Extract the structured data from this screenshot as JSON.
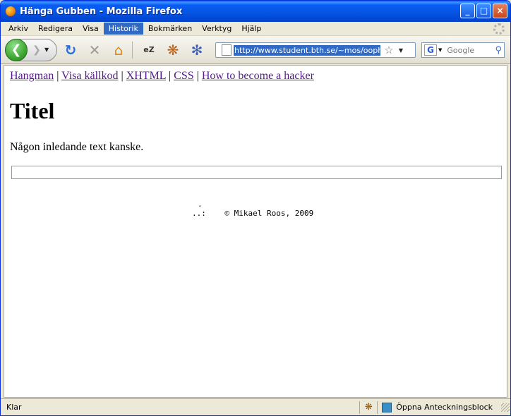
{
  "window": {
    "title": "Hänga Gubben - Mozilla Firefox"
  },
  "menu": {
    "items": [
      {
        "label": "Arkiv"
      },
      {
        "label": "Redigera"
      },
      {
        "label": "Visa"
      },
      {
        "label": "Historik",
        "active": true
      },
      {
        "label": "Bokmärken"
      },
      {
        "label": "Verktyg"
      },
      {
        "label": "Hjälp"
      }
    ]
  },
  "toolbar": {
    "icons": [
      "back-icon",
      "forward-icon",
      "reload-icon",
      "stop-icon",
      "home-icon",
      "ez-icon",
      "firebug-icon",
      "tor-icon"
    ],
    "url": "http://www.student.bth.se/~mos/oophp/m",
    "search_placeholder": "Google",
    "search_engine_icon": "G"
  },
  "page": {
    "links": [
      {
        "label": "Hangman"
      },
      {
        "label": "Visa källkod"
      },
      {
        "label": "XHTML"
      },
      {
        "label": "CSS"
      },
      {
        "label": "How to become a hacker"
      }
    ],
    "title": "Titel",
    "intro": "Någon inledande text kanske.",
    "footer_art_line1": ".",
    "footer_art_line2": "..:    © Mikael Roos, 2009"
  },
  "status": {
    "text": "Klar",
    "notes_label": "Öppna Anteckningsblock"
  },
  "colors": {
    "titlebar": "#0a5ef5",
    "link_visited": "#551a8b",
    "selection": "#316ac5"
  }
}
